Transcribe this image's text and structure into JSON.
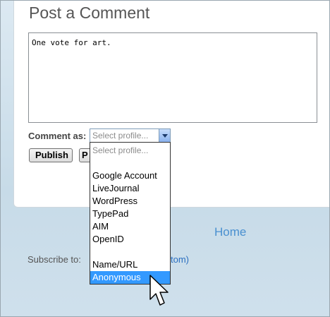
{
  "form": {
    "title": "Post a Comment",
    "comment_text": "One vote for art.",
    "comment_as_label": "Comment as:",
    "profile_select_value": "Select profile...",
    "publish_label": "Publish",
    "preview_label": "P"
  },
  "dropdown": {
    "options": [
      "Select profile...",
      "Google Account",
      "LiveJournal",
      "WordPress",
      "TypePad",
      "AIM",
      "OpenID",
      "Name/URL",
      "Anonymous"
    ],
    "highlighted": "Anonymous"
  },
  "footer": {
    "home_link": "Home",
    "subscribe_label": "Subscribe to:",
    "subscribe_fragment": "tom)"
  },
  "colors": {
    "highlight": "#3399ff",
    "link": "#4a90d0"
  }
}
